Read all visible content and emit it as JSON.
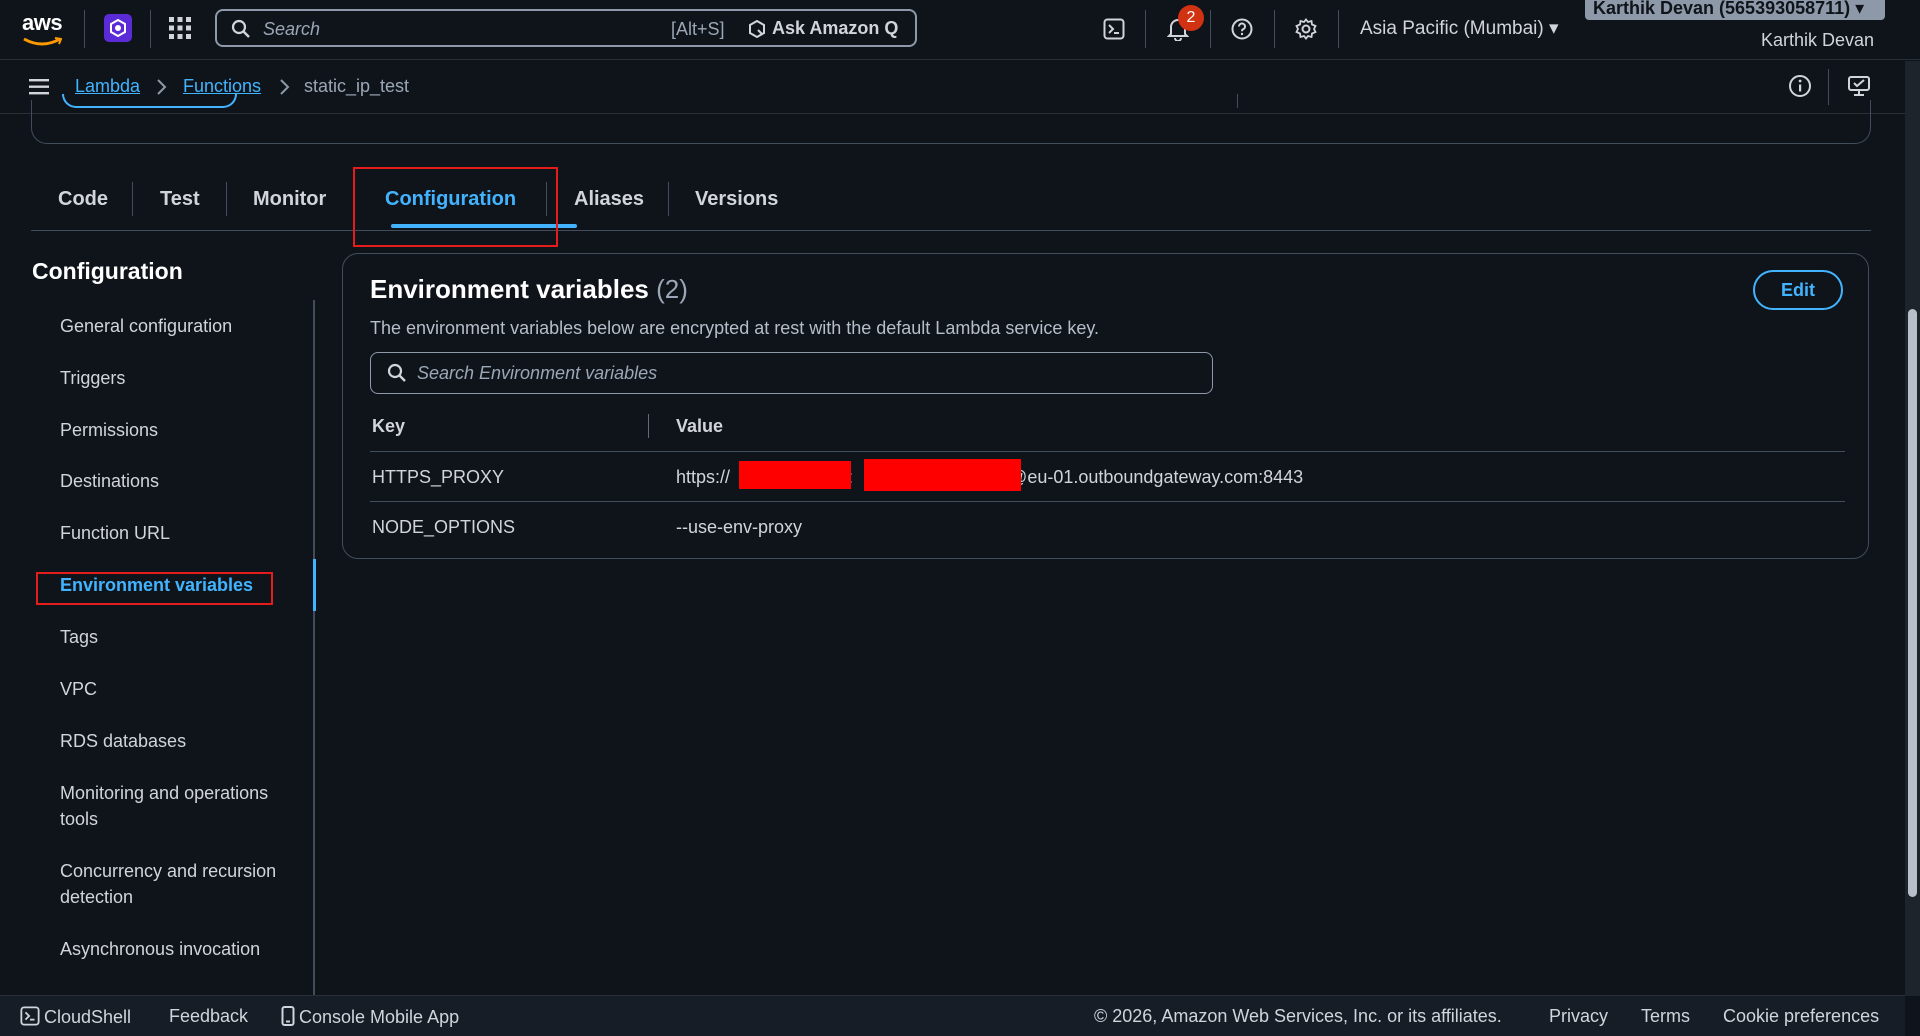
{
  "topnav": {
    "logo_text": "aws",
    "search_placeholder": "Search",
    "search_shortcut": "[Alt+S]",
    "ask_q_label": "Ask Amazon Q",
    "notification_count": "2",
    "region_label": "Asia Pacific (Mumbai) ▾",
    "account_pill": "Karthik Devan (565393058711) ▾",
    "account_name": "Karthik Devan"
  },
  "breadcrumb": {
    "items": [
      "Lambda",
      "Functions",
      "static_ip_test"
    ]
  },
  "tabs": [
    "Code",
    "Test",
    "Monitor",
    "Configuration",
    "Aliases",
    "Versions"
  ],
  "active_tab": "Configuration",
  "sidebar": {
    "title": "Configuration",
    "items": [
      "General configuration",
      "Triggers",
      "Permissions",
      "Destinations",
      "Function URL",
      "Environment variables",
      "Tags",
      "VPC",
      "RDS databases",
      "Monitoring and operations tools",
      "Concurrency and recursion detection",
      "Asynchronous invocation"
    ],
    "active": "Environment variables"
  },
  "env": {
    "title": "Environment variables",
    "count": "(2)",
    "description": "The environment variables below are encrypted at rest with the default Lambda service key.",
    "edit_label": "Edit",
    "search_placeholder": "Search Environment variables",
    "columns": [
      "Key",
      "Value"
    ],
    "rows": [
      {
        "key": "HTTPS_PROXY",
        "value_prefix": "https://",
        "value_mid": ":",
        "value_suffix": "@eu-01.outboundgateway.com:8443"
      },
      {
        "key": "NODE_OPTIONS",
        "value": "--use-env-proxy"
      }
    ]
  },
  "footer": {
    "cloudshell": "CloudShell",
    "feedback": "Feedback",
    "mobile_app": "Console Mobile App",
    "copyright": "© 2026, Amazon Web Services, Inc. or its affiliates.",
    "privacy": "Privacy",
    "terms": "Terms",
    "cookie": "Cookie preferences"
  },
  "colors": {
    "background": "#0f141a",
    "accent": "#42b4ff",
    "highlight_box": "#e41c1c",
    "redaction": "#ff0000",
    "badge": "#d13212"
  }
}
